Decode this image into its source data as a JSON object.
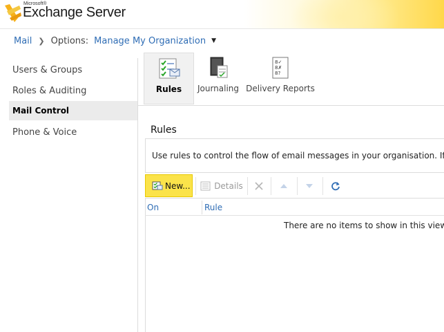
{
  "header": {
    "brand_small": "Microsoft®",
    "brand": "Exchange Server"
  },
  "breadcrumb": {
    "mail": "Mail",
    "options_label": "Options:",
    "current": "Manage My Organization"
  },
  "leftnav": {
    "items": [
      {
        "label": "Users & Groups"
      },
      {
        "label": "Roles & Auditing"
      },
      {
        "label": "Mail Control"
      },
      {
        "label": "Phone & Voice"
      }
    ],
    "active": "Mail Control"
  },
  "tabs": [
    {
      "label": "Rules",
      "icon": "rules-icon"
    },
    {
      "label": "Journaling",
      "icon": "journaling-icon"
    },
    {
      "label": "Delivery Reports",
      "icon": "delivery-reports-icon"
    }
  ],
  "main": {
    "title": "Rules",
    "description": "Use rules to control the flow of email messages in your organisation. If y",
    "toolbar": {
      "new_label": "New...",
      "details_label": "Details"
    },
    "grid": {
      "columns": [
        "On",
        "Rule"
      ],
      "empty_message": "There are no items to show in this view."
    }
  },
  "colors": {
    "link": "#2f6db5",
    "new_button": "#fbe34a",
    "active_nav": "#ebebeb"
  }
}
